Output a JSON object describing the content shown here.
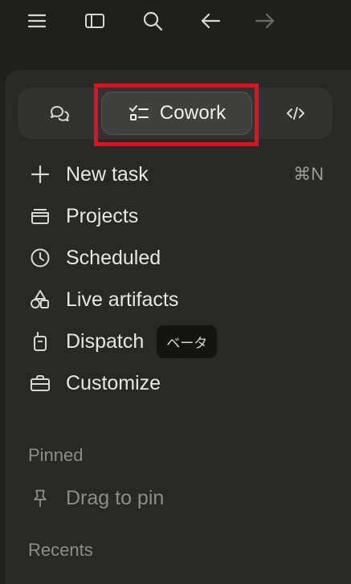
{
  "toolbar": {
    "icons": [
      "menu-icon",
      "sidebar-icon",
      "search-icon",
      "arrow-left-icon",
      "arrow-right-icon"
    ]
  },
  "modes": {
    "active_label": "Cowork",
    "items": [
      "chat-icon",
      "tasks-icon",
      "code-icon"
    ]
  },
  "menu": {
    "new_task": "New task",
    "new_task_shortcut": "⌘N",
    "projects": "Projects",
    "scheduled": "Scheduled",
    "live_artifacts": "Live artifacts",
    "dispatch": "Dispatch",
    "dispatch_badge": "ベータ",
    "customize": "Customize"
  },
  "pinned": {
    "title": "Pinned",
    "drag_hint": "Drag to pin"
  },
  "recents": {
    "title": "Recents"
  },
  "colors": {
    "highlight": "#e3101e",
    "panel": "#282827",
    "background": "#1f1f1e"
  }
}
